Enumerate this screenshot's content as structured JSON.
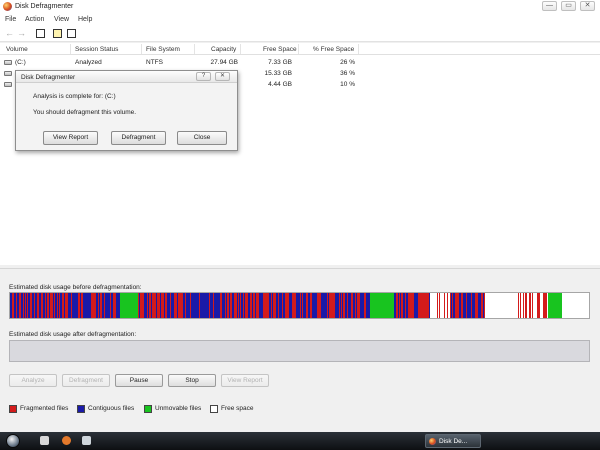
{
  "window": {
    "title": "Disk Defragmenter",
    "controls": [
      "—",
      "▭",
      "✕"
    ]
  },
  "menu": [
    "File",
    "Action",
    "View",
    "Help"
  ],
  "toolbar": {
    "back_icon": "back-arrow-icon",
    "forward_icon": "forward-arrow-icon"
  },
  "volumes": {
    "headers": [
      "Volume",
      "Session Status",
      "File System",
      "Capacity",
      "Free Space",
      "% Free Space"
    ],
    "rows": [
      {
        "volume": "(C:)",
        "status": "Analyzed",
        "fs": "NTFS",
        "capacity": "27.94 GB",
        "free": "7.33 GB",
        "pct": "26 %"
      },
      {
        "volume": "",
        "status": "",
        "fs": "",
        "capacity": "",
        "free": "15.33 GB",
        "pct": "36 %"
      },
      {
        "volume": "",
        "status": "",
        "fs": "",
        "capacity": "",
        "free": "4.44 GB",
        "pct": "10 %"
      }
    ]
  },
  "dialog": {
    "title": "Disk Defragmenter",
    "line1": "Analysis is complete for: (C:)",
    "line2": "You should defragment this volume.",
    "view_report": "View Report",
    "defragment": "Defragment",
    "close": "Close",
    "help_ctl": "?",
    "close_ctl": "✕"
  },
  "before_label": "Estimated disk usage before defragmentation:",
  "after_label": "Estimated disk usage after defragmentation:",
  "buttons": {
    "analyze": "Analyze",
    "defragment": "Defragment",
    "pause": "Pause",
    "stop": "Stop",
    "view_report": "View Report"
  },
  "legend": [
    {
      "label": "Fragmented files",
      "color": "#d31b1b"
    },
    {
      "label": "Contiguous files",
      "color": "#1a1aa8"
    },
    {
      "label": "Unmovable files",
      "color": "#18c41f"
    },
    {
      "label": "Free space",
      "color": "#ffffff"
    }
  ],
  "taskbar": {
    "task_label": "Disk De..."
  }
}
